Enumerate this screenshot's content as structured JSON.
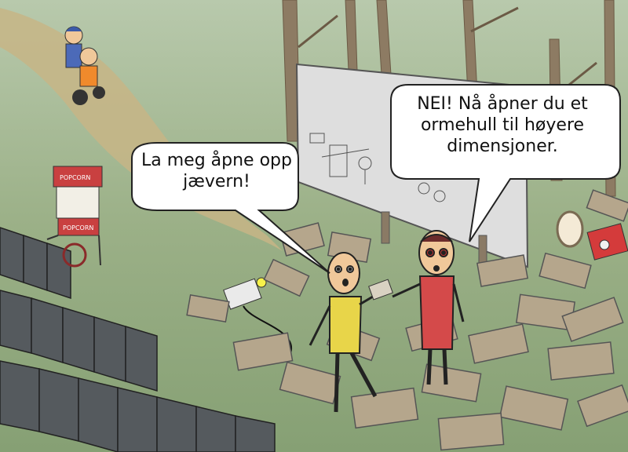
{
  "comic": {
    "speech_left": "La meg åpne opp jævern!",
    "speech_right": "NEI! Nå åpner du et ormehull til høyere dimensjoner."
  },
  "props": {
    "popcorn_cart_sign_top": "POPCORN",
    "popcorn_cart_sign_bottom": "POPCORN"
  },
  "colors": {
    "grass": "#8fa67c",
    "sky_fog": "#c9d6c0",
    "path": "#c7b586",
    "screen": "#dedede",
    "yellow_shirt": "#e8d549",
    "red_shirt": "#d44a4a",
    "chair": "#555a5e",
    "wood": "#b5a68c"
  }
}
